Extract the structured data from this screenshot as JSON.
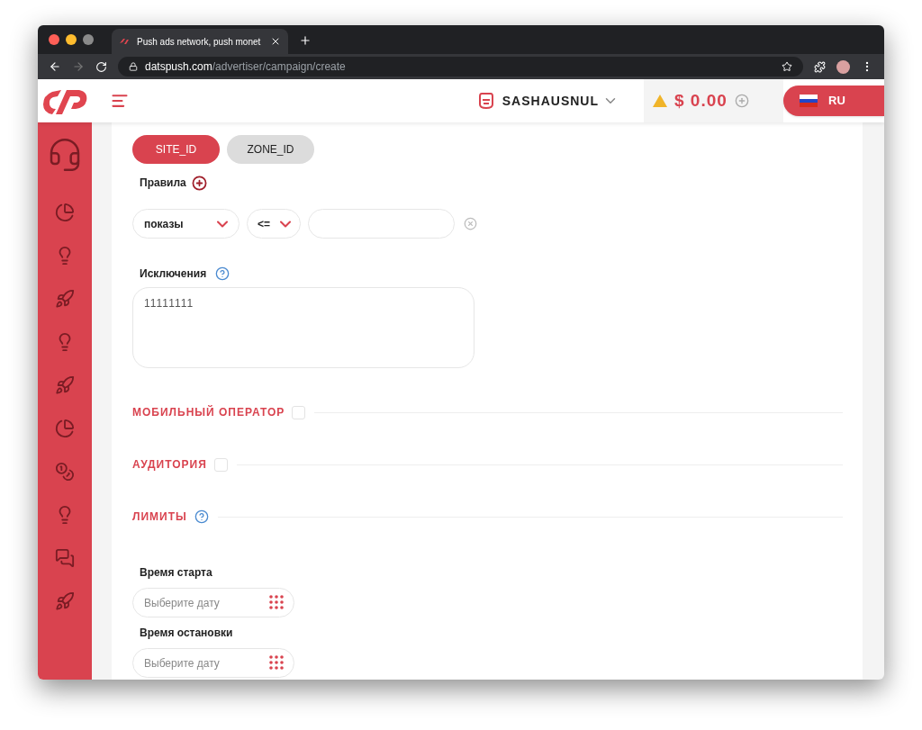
{
  "browser": {
    "tab_title": "Push ads network, push monet",
    "url_domain": "datspush.com",
    "url_path": "/advertiser/campaign/create"
  },
  "header": {
    "username": "SASHAUSNUL",
    "balance": "$ 0.00",
    "language": "RU"
  },
  "sidebar": {
    "items": [
      {
        "kind": "support"
      },
      {
        "kind": "pie"
      },
      {
        "kind": "bulb"
      },
      {
        "kind": "rocket"
      },
      {
        "kind": "bulb"
      },
      {
        "kind": "rocket"
      },
      {
        "kind": "pie"
      },
      {
        "kind": "coins"
      },
      {
        "kind": "bulb"
      },
      {
        "kind": "chat"
      },
      {
        "kind": "rocket"
      }
    ]
  },
  "filter_tabs": [
    {
      "label": "SITE_ID",
      "selected": true
    },
    {
      "label": "ZONE_ID",
      "selected": false
    }
  ],
  "rules": {
    "label": "Правила",
    "field": "показы",
    "operator": "<="
  },
  "exclusions": {
    "label": "Исключения",
    "value": "11111111"
  },
  "sections": [
    {
      "title": "МОБИЛЬНЫЙ ОПЕРАТОР",
      "kind": "checkbox",
      "checked": false
    },
    {
      "title": "АУДИТОРИЯ",
      "kind": "checkbox",
      "checked": false
    },
    {
      "title": "ЛИМИТЫ",
      "kind": "help"
    }
  ],
  "dates": [
    {
      "label": "Время старта",
      "placeholder": "Выберите дату"
    },
    {
      "label": "Время остановки",
      "placeholder": "Выберите дату"
    }
  ]
}
